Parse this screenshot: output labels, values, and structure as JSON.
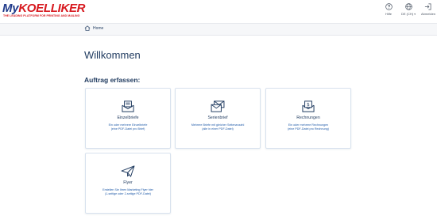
{
  "brand": {
    "logo_my": "My",
    "logo_name": "KOELLIKER",
    "tagline": "THE LEADING PLATFORM FOR PRINTING AND MAILING"
  },
  "header": {
    "help_label": "Hilfe",
    "language_label": "DE (CH)",
    "logout_label": "Abmelden"
  },
  "breadcrumb": {
    "home_label": "Home"
  },
  "main": {
    "title": "Willkommen",
    "section_title": "Auftrag erfassen:",
    "cards": [
      {
        "title": "Einzelbriefe",
        "desc_line1": "Ein oder mehrere Einzelbriefe",
        "desc_line2": "(eine PDF-Datei pro Brief)",
        "icon": "envelope-letter-icon"
      },
      {
        "title": "Serienbrief",
        "desc_line1": "Mehrere Briefe mit gleicher Seitenanzahl",
        "desc_line2": "(alle in einer PDF-Datei)",
        "icon": "stacked-envelopes-icon"
      },
      {
        "title": "Rechnungen",
        "desc_line1": "Ein oder mehrere Rechnungen",
        "desc_line2": "(eine PDF-Datei pro Rechnung)",
        "icon": "invoice-envelope-icon"
      },
      {
        "title": "Flyer",
        "desc_line1": "Erstellen Sie Ihren Marketing Flyer hier",
        "desc_line2": "(1-seitige oder 2-seitige PDF-Datei)",
        "icon": "paper-plane-icon"
      }
    ]
  },
  "colors": {
    "brand_red": "#d7191f",
    "brand_navy": "#1f3a8a",
    "text": "#1f3a5f",
    "link_blue": "#1f5aa8"
  }
}
